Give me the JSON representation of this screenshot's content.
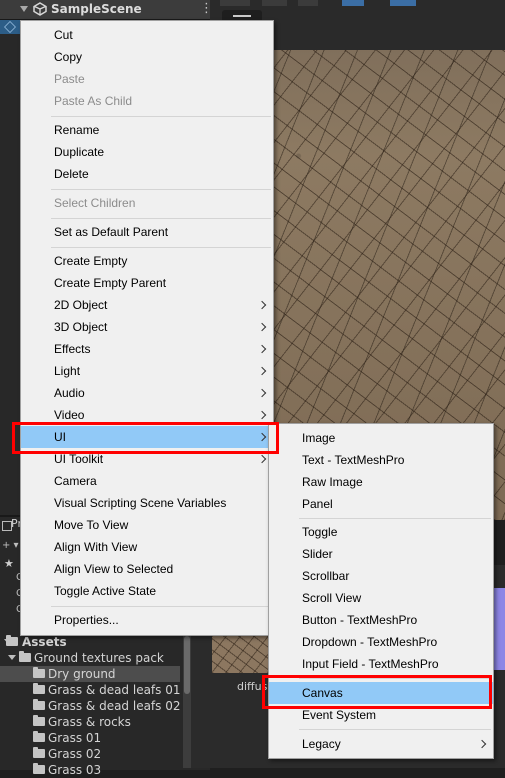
{
  "hierarchy": {
    "scene_title": "SampleScene",
    "kebab": "⋮"
  },
  "project": {
    "tab_label": "Pr",
    "small_labels": [
      "C",
      "C",
      "C"
    ],
    "tree": [
      {
        "label": "Assets",
        "bold": true
      },
      {
        "label": "Ground textures pack"
      },
      {
        "label": "Dry ground",
        "selected": true
      },
      {
        "label": "Grass & dead leafs 01"
      },
      {
        "label": "Grass & dead leafs 02"
      },
      {
        "label": "Grass & rocks"
      },
      {
        "label": "Grass 01"
      },
      {
        "label": "Grass 02"
      },
      {
        "label": "Grass 03"
      }
    ],
    "asset_label": "diffuse"
  },
  "context_menu": {
    "items": [
      {
        "label": "Cut",
        "disabled": false
      },
      {
        "label": "Copy",
        "disabled": false
      },
      {
        "label": "Paste",
        "disabled": true
      },
      {
        "label": "Paste As Child",
        "disabled": true
      },
      {
        "label": "Rename",
        "disabled": false
      },
      {
        "label": "Duplicate",
        "disabled": false
      },
      {
        "label": "Delete",
        "disabled": false
      },
      {
        "label": "Select Children",
        "disabled": true
      },
      {
        "label": "Set as Default Parent",
        "disabled": false
      },
      {
        "label": "Create Empty",
        "disabled": false
      },
      {
        "label": "Create Empty Parent",
        "disabled": false
      },
      {
        "label": "2D Object",
        "submenu": true
      },
      {
        "label": "3D Object",
        "submenu": true
      },
      {
        "label": "Effects",
        "submenu": true
      },
      {
        "label": "Light",
        "submenu": true
      },
      {
        "label": "Audio",
        "submenu": true
      },
      {
        "label": "Video",
        "submenu": true
      },
      {
        "label": "UI",
        "submenu": true,
        "highlighted": true
      },
      {
        "label": "UI Toolkit",
        "submenu": true
      },
      {
        "label": "Camera"
      },
      {
        "label": "Visual Scripting Scene Variables"
      },
      {
        "label": "Move To View"
      },
      {
        "label": "Align With View"
      },
      {
        "label": "Align View to Selected"
      },
      {
        "label": "Toggle Active State"
      },
      {
        "label": "Properties..."
      }
    ]
  },
  "ui_submenu": {
    "items": [
      {
        "label": "Image"
      },
      {
        "label": "Text - TextMeshPro"
      },
      {
        "label": "Raw Image"
      },
      {
        "label": "Panel"
      },
      {
        "label": "Toggle"
      },
      {
        "label": "Slider"
      },
      {
        "label": "Scrollbar"
      },
      {
        "label": "Scroll View"
      },
      {
        "label": "Button - TextMeshPro"
      },
      {
        "label": "Dropdown - TextMeshPro"
      },
      {
        "label": "Input Field - TextMeshPro"
      },
      {
        "label": "Canvas",
        "highlighted": true
      },
      {
        "label": "Event System"
      },
      {
        "label": "Legacy",
        "submenu": true
      }
    ]
  },
  "colors": {
    "menu_bg": "#f0f0f0",
    "highlight": "#91c9f7",
    "annotation_red": "#ff0000"
  }
}
